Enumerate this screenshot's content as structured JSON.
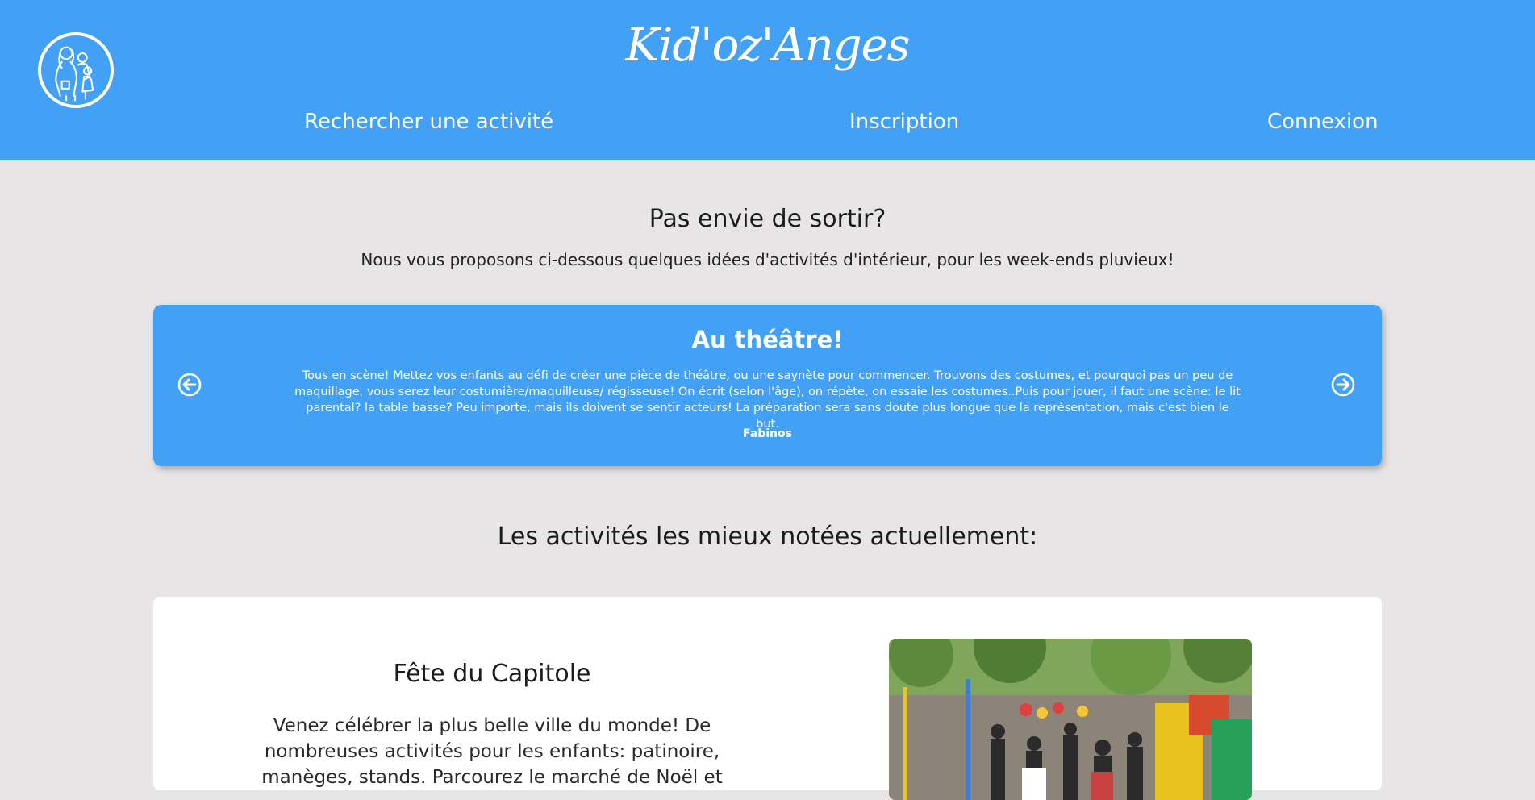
{
  "header": {
    "brand": "Kid'oz'Anges",
    "nav": {
      "search": "Rechercher une activité",
      "signup": "Inscription",
      "login": "Connexion"
    },
    "logo_icon": "family-illustration-icon"
  },
  "intro": {
    "title": "Pas envie de sortir?",
    "text": "Nous vous proposons ci-dessous quelques idées d'activités d'intérieur, pour les week-ends pluvieux!"
  },
  "carousel": {
    "slide_title": "Au théâtre!",
    "slide_text": "Tous en scène! Mettez vos enfants au défi de créer une pièce de théâtre, ou une saynète pour commencer. Trouvons des costumes, et pourquoi pas un peu de maquillage, vous serez leur costumière/maquilleuse/ régisseuse! On écrit (selon l'âge), on répète, on essaie les costumes..Puis pour jouer, il faut une scène: le lit parental? la table basse? Peu importe, mais ils doivent se sentir acteurs! La préparation sera sans doute plus longue que la représentation, mais c'est bien le but.",
    "slide_author": "Fabinos",
    "prev_icon": "circle-arrow-left-icon",
    "next_icon": "circle-arrow-right-icon"
  },
  "top_activities": {
    "title": "Les activités les mieux notées actuellement:",
    "items": [
      {
        "title": "Fête du Capitole",
        "description": "Venez célébrer la plus belle ville du monde! De nombreuses activités pour les enfants: patinoire, manèges, stands. Parcourez le marché de Noël et"
      }
    ]
  },
  "colors": {
    "primary": "#43a1f5",
    "background": "#e7e5e6",
    "card": "#ffffff"
  }
}
